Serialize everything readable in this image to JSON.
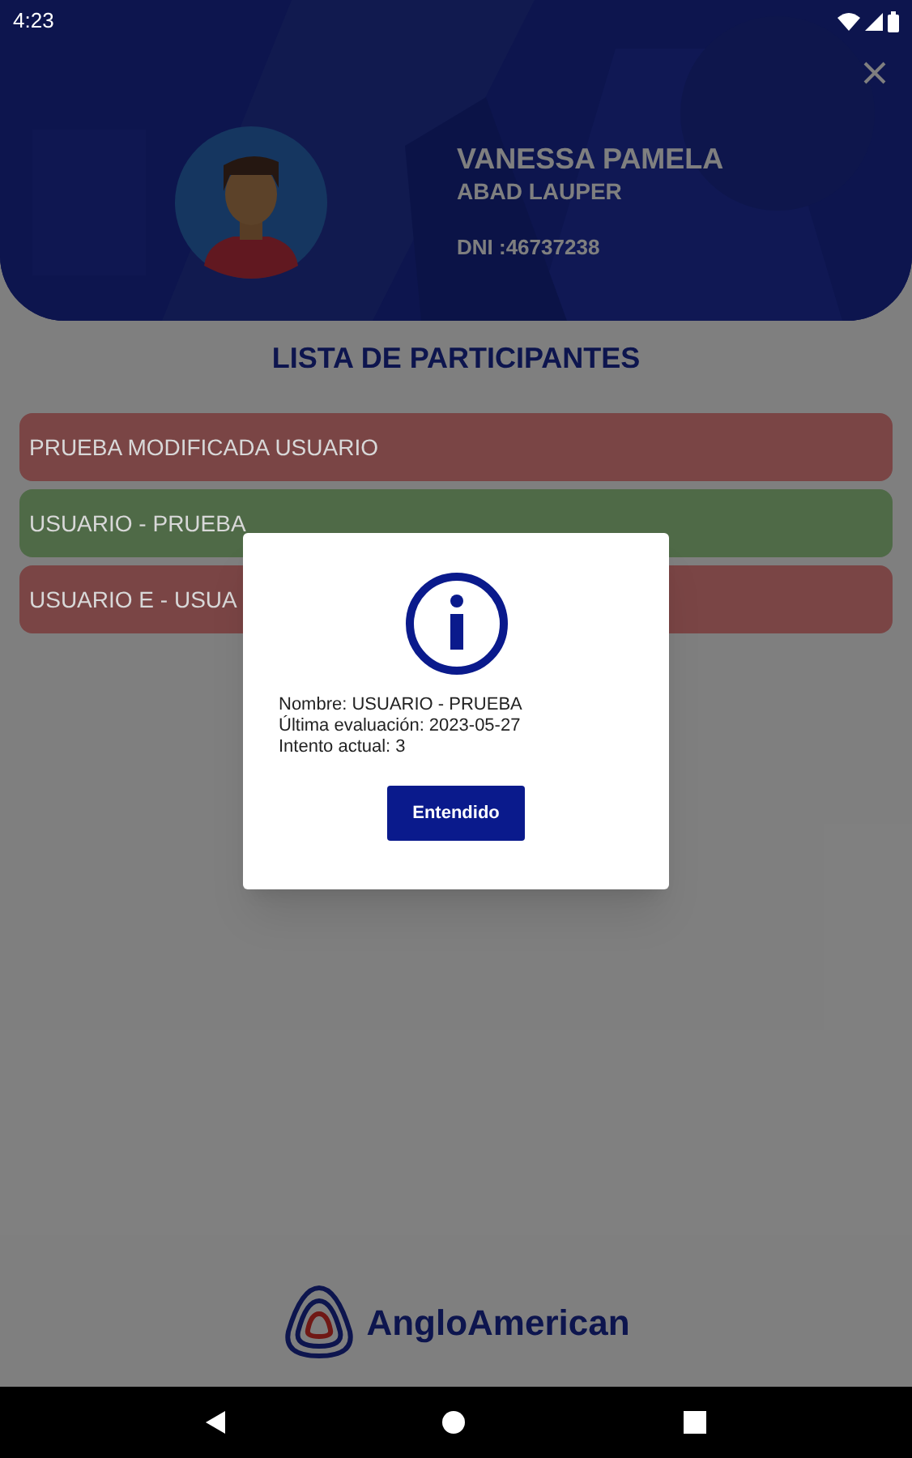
{
  "status_bar": {
    "time": "4:23"
  },
  "profile": {
    "first_names": "VANESSA PAMELA",
    "last_names": "ABAD LAUPER",
    "dni": "DNI :46737238"
  },
  "list_title": "LISTA DE PARTICIPANTES",
  "participants": [
    {
      "name": "PRUEBA MODIFICADA USUARIO",
      "color": "#7a4545"
    },
    {
      "name": "USUARIO - PRUEBA",
      "color": "#4f6a47"
    },
    {
      "name": "USUARIO E - USUA",
      "color": "#7a4545"
    }
  ],
  "dialog": {
    "lines": [
      "Nombre: USUARIO - PRUEBA",
      "Última evaluación: 2023-05-27",
      "Intento actual: 3"
    ],
    "button": "Entendido"
  },
  "logo": {
    "text": "AngloAmerican"
  }
}
